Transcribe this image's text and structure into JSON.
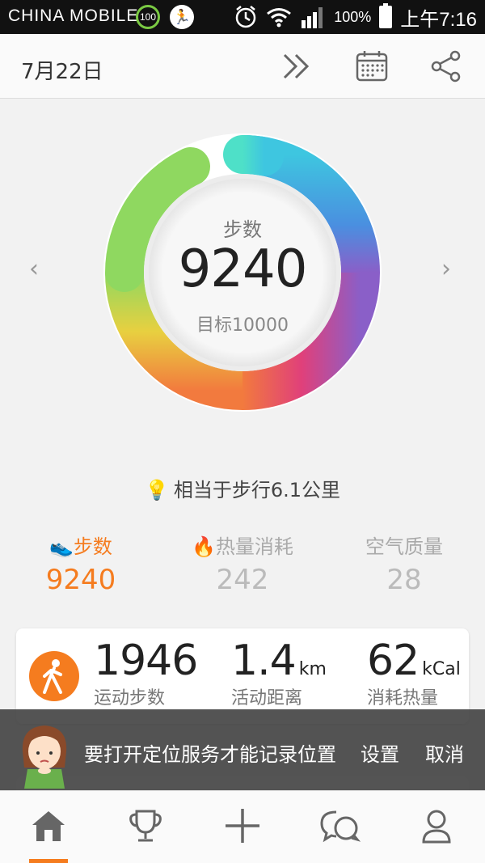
{
  "status_bar": {
    "carrier": "CHINA MOBILE",
    "badge": "100",
    "battery_percent": "100%",
    "time": "上午7:16"
  },
  "header": {
    "date": "7月22日",
    "icons": [
      "fast-forward-icon",
      "calendar-icon",
      "share-icon"
    ]
  },
  "ring": {
    "label": "步数",
    "value": "9240",
    "goal": "目标10000",
    "progress": 0.924
  },
  "tip": {
    "text": "相当于步行6.1公里"
  },
  "stats": [
    {
      "title": "步数",
      "value": "9240",
      "active": true
    },
    {
      "title": "热量消耗",
      "value": "242",
      "active": false
    },
    {
      "title": "空气质量",
      "value": "28",
      "active": false
    }
  ],
  "activity_card": {
    "steps": {
      "value": "1946",
      "label": "运动步数"
    },
    "distance": {
      "value": "1.4",
      "unit": "km",
      "label": "活动距离"
    },
    "calories": {
      "value": "62",
      "unit": "kCal",
      "label": "消耗热量"
    }
  },
  "toast": {
    "message": "要打开定位服务才能记录位置",
    "settings": "设置",
    "cancel": "取消"
  },
  "colors": {
    "accent": "#f57c1f",
    "toast_bg": "#3c3c3c"
  }
}
